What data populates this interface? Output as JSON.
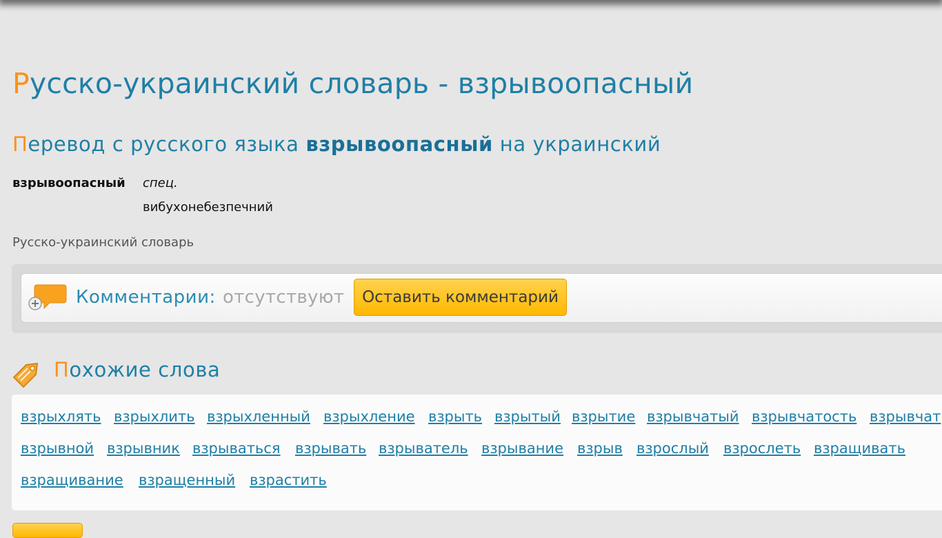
{
  "header": {
    "title_first": "Р",
    "title_rest": "усско-украинский словарь - взрывоопасный"
  },
  "translation_heading": {
    "first": "П",
    "before": "еревод с русского языка ",
    "word": "взрывоопасный",
    "after": " на украинский"
  },
  "entry": {
    "headword": "взрывоопасный",
    "marker": "спец.",
    "translation": "вибухонебезпечний"
  },
  "source": "Русско-украинский словарь",
  "comments": {
    "label": "Комментарии:",
    "status": "отсутствуют",
    "button": "Оставить комментарий"
  },
  "similar": {
    "title_first": "П",
    "title_rest": "охожие слова",
    "rows": [
      [
        "взрыхлять",
        "взрыхлить",
        "взрыхленный",
        "взрыхление",
        "взрыть",
        "взрытый",
        "взрытие",
        "взрывчатый",
        "взрывчатость",
        "взрывчат"
      ],
      [
        "взрывной",
        "взрывник",
        "взрываться",
        "взрывать",
        "взрыватель",
        "взрывание",
        "взрыв",
        "взрослый",
        "взрослеть",
        "взращивать"
      ],
      [
        "взращивание",
        "взращенный",
        "взрастить"
      ]
    ]
  },
  "colors": {
    "background": "#e6e6e6",
    "heading_blue": "#1f7fa6",
    "accent_orange": "#f7931e",
    "button_yellow": "#ffc21f"
  }
}
